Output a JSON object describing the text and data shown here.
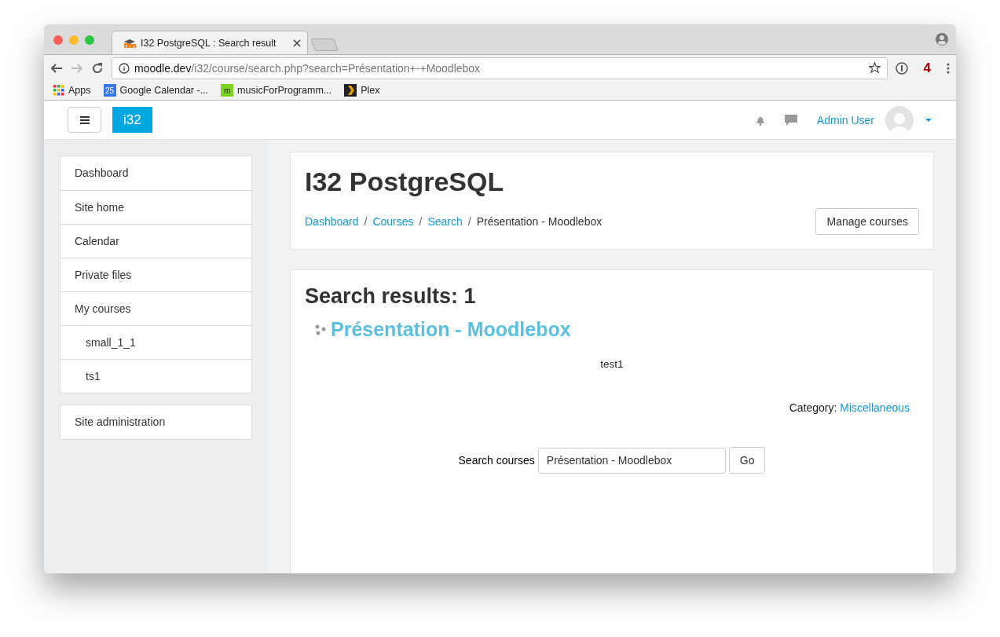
{
  "browser": {
    "tab_title": "I32 PostgreSQL : Search result",
    "url_host": "moodle.dev",
    "url_path": "/i32/course/search.php?search=Présentation+-+Moodlebox",
    "extension_badge": "4",
    "bookmarks": [
      {
        "label": "Apps",
        "kind": "apps"
      },
      {
        "label": "Google Calendar -...",
        "kind": "calendar",
        "badge": "25"
      },
      {
        "label": "musicForProgramm...",
        "kind": "music",
        "badge": "m"
      },
      {
        "label": "Plex",
        "kind": "plex"
      }
    ]
  },
  "navbar": {
    "logo": "i32",
    "user_name": "Admin User"
  },
  "sidebar": {
    "blocks": [
      [
        {
          "label": "Dashboard"
        },
        {
          "label": "Site home"
        },
        {
          "label": "Calendar"
        },
        {
          "label": "Private files"
        },
        {
          "label": "My courses",
          "children": [
            {
              "label": "small_1_1"
            },
            {
              "label": "ts1"
            }
          ]
        }
      ],
      [
        {
          "label": "Site administration"
        }
      ]
    ]
  },
  "header": {
    "title": "I32 PostgreSQL",
    "separator": "/",
    "breadcrumbs": [
      {
        "label": "Dashboard",
        "link": true
      },
      {
        "label": "Courses",
        "link": true
      },
      {
        "label": "Search",
        "link": true
      },
      {
        "label": "Présentation - Moodlebox",
        "link": false
      }
    ],
    "button": "Manage courses"
  },
  "results": {
    "heading": "Search results: 1",
    "course": {
      "name": "Présentation - Moodlebox",
      "summary": "test1",
      "category_label": "Category:",
      "category": "Miscellaneous"
    }
  },
  "search": {
    "label": "Search courses",
    "value": "Présentation - Moodlebox",
    "button": "Go"
  }
}
